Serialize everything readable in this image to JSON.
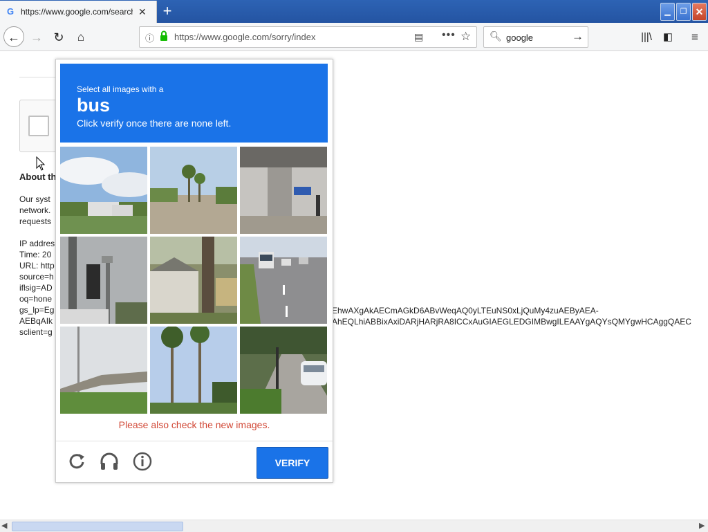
{
  "browser": {
    "tab_title": "https://www.google.com/search?",
    "favicon": "G",
    "url": "https://www.google.com/sorry/index",
    "search_value": "google",
    "icons": [
      "back-icon",
      "forward-icon",
      "reload-icon",
      "home-icon",
      "info-icon",
      "lock-icon",
      "reader-icon",
      "more-icon",
      "star-icon",
      "search-icon",
      "arrow-right-icon",
      "library-icon",
      "sidebar-icon",
      "menu-icon"
    ]
  },
  "page": {
    "heading": "About th",
    "lines": [
      "Our syst",
      "network.",
      "requests"
    ],
    "ip_lines": [
      "IP addres",
      "Time: 20",
      "URL: http",
      "source=h",
      "iflsig=AD",
      "oq=hone",
      "gs_lp=Eg",
      "AEBqAIk",
      "sclient=g"
    ],
    "frag1": "EhwAXgAkAECmAGkD6ABvWeqAQ0yLTEuNS0xLjQuMy4zuAEByAEA-",
    "frag2": "AhEQLhiABBixAxiDARjHARjRA8ICCxAuGIAEGLEDGIMBwgILEAAYgAQYsQMYgwHCAggQAEC"
  },
  "captcha": {
    "instruction_top": "Select all images with a",
    "target": "bus",
    "instruction_bottom": "Click verify once there are none left.",
    "message": "Please also check the new images.",
    "verify_label": "VERIFY",
    "accent_color": "#1a73e8",
    "error_color": "#d14836"
  }
}
